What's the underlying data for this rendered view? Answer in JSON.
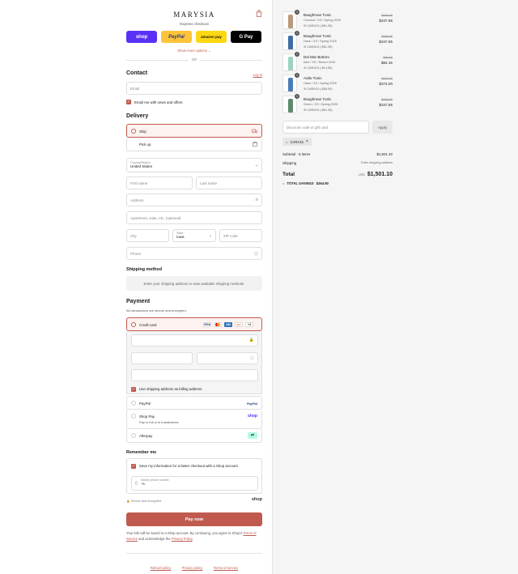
{
  "store": {
    "logo": "MARYSIA",
    "express_label": "Express checkout",
    "show_more": "Show more options ⌄",
    "or": "OR"
  },
  "express": {
    "shop": "shop",
    "paypal": "PayPal",
    "amazon": "amazon pay",
    "gpay": "G Pay"
  },
  "contact": {
    "title": "Contact",
    "login": "Log in",
    "email_placeholder": "Email",
    "news_label": "Email me with news and offers"
  },
  "delivery": {
    "title": "Delivery",
    "ship": "Ship",
    "pickup": "Pick up",
    "country_label": "Country/Region",
    "country_value": "United States",
    "first_name": "First name",
    "last_name": "Last name",
    "address": "Address",
    "apartment": "Apartment, suite, etc. (optional)",
    "city": "City",
    "state_label": "State",
    "state_value": "Iowa",
    "zip": "ZIP code",
    "phone": "Phone"
  },
  "shipping_method": {
    "title": "Shipping method",
    "note": "Enter your shipping address to view available shipping methods."
  },
  "payment": {
    "title": "Payment",
    "subtitle": "All transactions are secure and encrypted.",
    "credit_card": "Credit card",
    "more_cards": "+4",
    "billing_same": "Use shipping address as billing address",
    "paypal": "PayPal",
    "paypal_logo": "PayPal",
    "shop_pay": "Shop Pay",
    "shop_pay_sub": "Pay in full or in installments",
    "shop_logo": "shop",
    "afterpay": "Afterpay"
  },
  "remember": {
    "title": "Remember me",
    "save_label": "Save my information for a faster checkout with a Shop account",
    "phone_label": "Mobile phone number",
    "phone_value": "+1",
    "secure": "Secure and encrypted",
    "shop": "shop"
  },
  "pay_now": "Pay now",
  "legal": {
    "line1": "Your info will be saved to a Shop account. By continuing, you agree to Shop's",
    "tos": "Terms of Service",
    "and": "and acknowledge the",
    "privacy": "Privacy Policy",
    "end": "."
  },
  "footer": {
    "refund": "Refund policy",
    "privacy": "Privacy policy",
    "terms": "Terms of service"
  },
  "items": [
    {
      "qty": "1",
      "name": "Baughman Tunic",
      "variant": "Coconut / XS / Spring 2025",
      "code": "CARA15 (-$61.35)",
      "old": "$409.00",
      "price": "$347.65",
      "color": "#b99a7c"
    },
    {
      "qty": "1",
      "name": "Baughman Tunic",
      "variant": "Haze / XS / Spring 2025",
      "code": "CARA15 (-$61.35)",
      "old": "$409.00",
      "price": "$347.65",
      "color": "#3f6ea6"
    },
    {
      "qty": "1",
      "name": "Del Mar Bottom",
      "variant": "Mint / XS / Resort 2025",
      "code": "CARA15 (-$14.85)",
      "old": "$99.00",
      "price": "$84.15",
      "color": "#9fd3c0"
    },
    {
      "qty": "1",
      "name": "Aalto Tunic",
      "variant": "Haze / XS / Spring 2025",
      "code": "CARA15 (-$66.00)",
      "old": "$440.00",
      "price": "$374.00",
      "color": "#4a7fb6"
    },
    {
      "qty": "1",
      "name": "Baughman Tunic",
      "variant": "Green / XS / Spring 2025",
      "code": "CARA15 (-$61.35)",
      "old": "$409.00",
      "price": "$347.65",
      "color": "#5f8a6a"
    }
  ],
  "discount": {
    "placeholder": "Discount code or gift card",
    "apply": "Apply",
    "tag": "CARA15"
  },
  "summary": {
    "subtotal_label": "Subtotal · 5 items",
    "subtotal": "$1,501.10",
    "shipping_label": "Shipping",
    "shipping": "Enter shipping address",
    "total_label": "Total",
    "currency": "USD",
    "total": "$1,501.10",
    "savings_label": "TOTAL SAVINGS",
    "savings": "$264.90"
  },
  "colors": {
    "accent": "#c05a4e",
    "shop": "#5a31f4",
    "paypal": "#ffc439",
    "amazon": "#ffd814",
    "gpay": "#000000"
  }
}
